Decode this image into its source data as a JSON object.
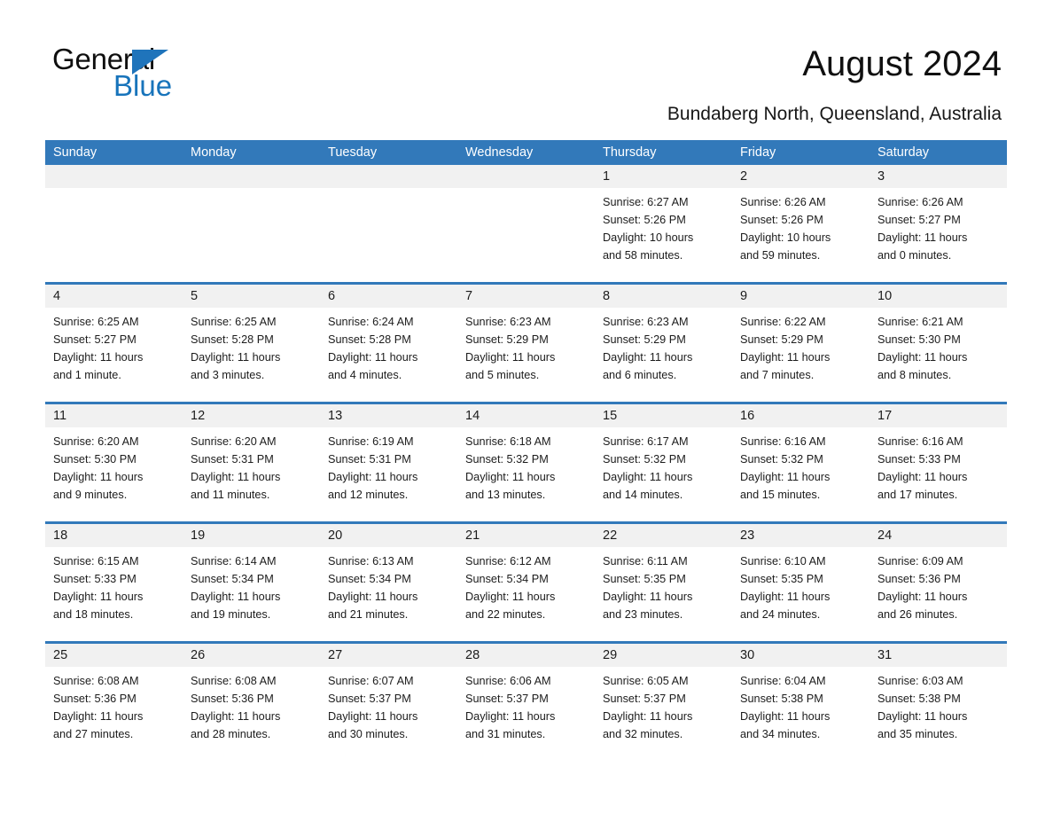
{
  "brand": {
    "name_part1": "General",
    "name_part2": "Blue",
    "triangle_color": "#1f74bb",
    "blue_color": "#1874bb"
  },
  "header": {
    "title": "August 2024",
    "subtitle": "Bundaberg North, Queensland, Australia"
  },
  "theme": {
    "header_blue": "#3279ba",
    "day_strip_gray": "#f1f1f1",
    "text": "#1c1c1c",
    "header_text": "#ffffff"
  },
  "weekdays": [
    "Sunday",
    "Monday",
    "Tuesday",
    "Wednesday",
    "Thursday",
    "Friday",
    "Saturday"
  ],
  "weeks": [
    [
      {
        "day": "",
        "empty": true
      },
      {
        "day": "",
        "empty": true
      },
      {
        "day": "",
        "empty": true
      },
      {
        "day": "",
        "empty": true
      },
      {
        "day": "1",
        "sunrise": "Sunrise: 6:27 AM",
        "sunset": "Sunset: 5:26 PM",
        "daylight1": "Daylight: 10 hours",
        "daylight2": "and 58 minutes."
      },
      {
        "day": "2",
        "sunrise": "Sunrise: 6:26 AM",
        "sunset": "Sunset: 5:26 PM",
        "daylight1": "Daylight: 10 hours",
        "daylight2": "and 59 minutes."
      },
      {
        "day": "3",
        "sunrise": "Sunrise: 6:26 AM",
        "sunset": "Sunset: 5:27 PM",
        "daylight1": "Daylight: 11 hours",
        "daylight2": "and 0 minutes."
      }
    ],
    [
      {
        "day": "4",
        "sunrise": "Sunrise: 6:25 AM",
        "sunset": "Sunset: 5:27 PM",
        "daylight1": "Daylight: 11 hours",
        "daylight2": "and 1 minute."
      },
      {
        "day": "5",
        "sunrise": "Sunrise: 6:25 AM",
        "sunset": "Sunset: 5:28 PM",
        "daylight1": "Daylight: 11 hours",
        "daylight2": "and 3 minutes."
      },
      {
        "day": "6",
        "sunrise": "Sunrise: 6:24 AM",
        "sunset": "Sunset: 5:28 PM",
        "daylight1": "Daylight: 11 hours",
        "daylight2": "and 4 minutes."
      },
      {
        "day": "7",
        "sunrise": "Sunrise: 6:23 AM",
        "sunset": "Sunset: 5:29 PM",
        "daylight1": "Daylight: 11 hours",
        "daylight2": "and 5 minutes."
      },
      {
        "day": "8",
        "sunrise": "Sunrise: 6:23 AM",
        "sunset": "Sunset: 5:29 PM",
        "daylight1": "Daylight: 11 hours",
        "daylight2": "and 6 minutes."
      },
      {
        "day": "9",
        "sunrise": "Sunrise: 6:22 AM",
        "sunset": "Sunset: 5:29 PM",
        "daylight1": "Daylight: 11 hours",
        "daylight2": "and 7 minutes."
      },
      {
        "day": "10",
        "sunrise": "Sunrise: 6:21 AM",
        "sunset": "Sunset: 5:30 PM",
        "daylight1": "Daylight: 11 hours",
        "daylight2": "and 8 minutes."
      }
    ],
    [
      {
        "day": "11",
        "sunrise": "Sunrise: 6:20 AM",
        "sunset": "Sunset: 5:30 PM",
        "daylight1": "Daylight: 11 hours",
        "daylight2": "and 9 minutes."
      },
      {
        "day": "12",
        "sunrise": "Sunrise: 6:20 AM",
        "sunset": "Sunset: 5:31 PM",
        "daylight1": "Daylight: 11 hours",
        "daylight2": "and 11 minutes."
      },
      {
        "day": "13",
        "sunrise": "Sunrise: 6:19 AM",
        "sunset": "Sunset: 5:31 PM",
        "daylight1": "Daylight: 11 hours",
        "daylight2": "and 12 minutes."
      },
      {
        "day": "14",
        "sunrise": "Sunrise: 6:18 AM",
        "sunset": "Sunset: 5:32 PM",
        "daylight1": "Daylight: 11 hours",
        "daylight2": "and 13 minutes."
      },
      {
        "day": "15",
        "sunrise": "Sunrise: 6:17 AM",
        "sunset": "Sunset: 5:32 PM",
        "daylight1": "Daylight: 11 hours",
        "daylight2": "and 14 minutes."
      },
      {
        "day": "16",
        "sunrise": "Sunrise: 6:16 AM",
        "sunset": "Sunset: 5:32 PM",
        "daylight1": "Daylight: 11 hours",
        "daylight2": "and 15 minutes."
      },
      {
        "day": "17",
        "sunrise": "Sunrise: 6:16 AM",
        "sunset": "Sunset: 5:33 PM",
        "daylight1": "Daylight: 11 hours",
        "daylight2": "and 17 minutes."
      }
    ],
    [
      {
        "day": "18",
        "sunrise": "Sunrise: 6:15 AM",
        "sunset": "Sunset: 5:33 PM",
        "daylight1": "Daylight: 11 hours",
        "daylight2": "and 18 minutes."
      },
      {
        "day": "19",
        "sunrise": "Sunrise: 6:14 AM",
        "sunset": "Sunset: 5:34 PM",
        "daylight1": "Daylight: 11 hours",
        "daylight2": "and 19 minutes."
      },
      {
        "day": "20",
        "sunrise": "Sunrise: 6:13 AM",
        "sunset": "Sunset: 5:34 PM",
        "daylight1": "Daylight: 11 hours",
        "daylight2": "and 21 minutes."
      },
      {
        "day": "21",
        "sunrise": "Sunrise: 6:12 AM",
        "sunset": "Sunset: 5:34 PM",
        "daylight1": "Daylight: 11 hours",
        "daylight2": "and 22 minutes."
      },
      {
        "day": "22",
        "sunrise": "Sunrise: 6:11 AM",
        "sunset": "Sunset: 5:35 PM",
        "daylight1": "Daylight: 11 hours",
        "daylight2": "and 23 minutes."
      },
      {
        "day": "23",
        "sunrise": "Sunrise: 6:10 AM",
        "sunset": "Sunset: 5:35 PM",
        "daylight1": "Daylight: 11 hours",
        "daylight2": "and 24 minutes."
      },
      {
        "day": "24",
        "sunrise": "Sunrise: 6:09 AM",
        "sunset": "Sunset: 5:36 PM",
        "daylight1": "Daylight: 11 hours",
        "daylight2": "and 26 minutes."
      }
    ],
    [
      {
        "day": "25",
        "sunrise": "Sunrise: 6:08 AM",
        "sunset": "Sunset: 5:36 PM",
        "daylight1": "Daylight: 11 hours",
        "daylight2": "and 27 minutes."
      },
      {
        "day": "26",
        "sunrise": "Sunrise: 6:08 AM",
        "sunset": "Sunset: 5:36 PM",
        "daylight1": "Daylight: 11 hours",
        "daylight2": "and 28 minutes."
      },
      {
        "day": "27",
        "sunrise": "Sunrise: 6:07 AM",
        "sunset": "Sunset: 5:37 PM",
        "daylight1": "Daylight: 11 hours",
        "daylight2": "and 30 minutes."
      },
      {
        "day": "28",
        "sunrise": "Sunrise: 6:06 AM",
        "sunset": "Sunset: 5:37 PM",
        "daylight1": "Daylight: 11 hours",
        "daylight2": "and 31 minutes."
      },
      {
        "day": "29",
        "sunrise": "Sunrise: 6:05 AM",
        "sunset": "Sunset: 5:37 PM",
        "daylight1": "Daylight: 11 hours",
        "daylight2": "and 32 minutes."
      },
      {
        "day": "30",
        "sunrise": "Sunrise: 6:04 AM",
        "sunset": "Sunset: 5:38 PM",
        "daylight1": "Daylight: 11 hours",
        "daylight2": "and 34 minutes."
      },
      {
        "day": "31",
        "sunrise": "Sunrise: 6:03 AM",
        "sunset": "Sunset: 5:38 PM",
        "daylight1": "Daylight: 11 hours",
        "daylight2": "and 35 minutes."
      }
    ]
  ]
}
